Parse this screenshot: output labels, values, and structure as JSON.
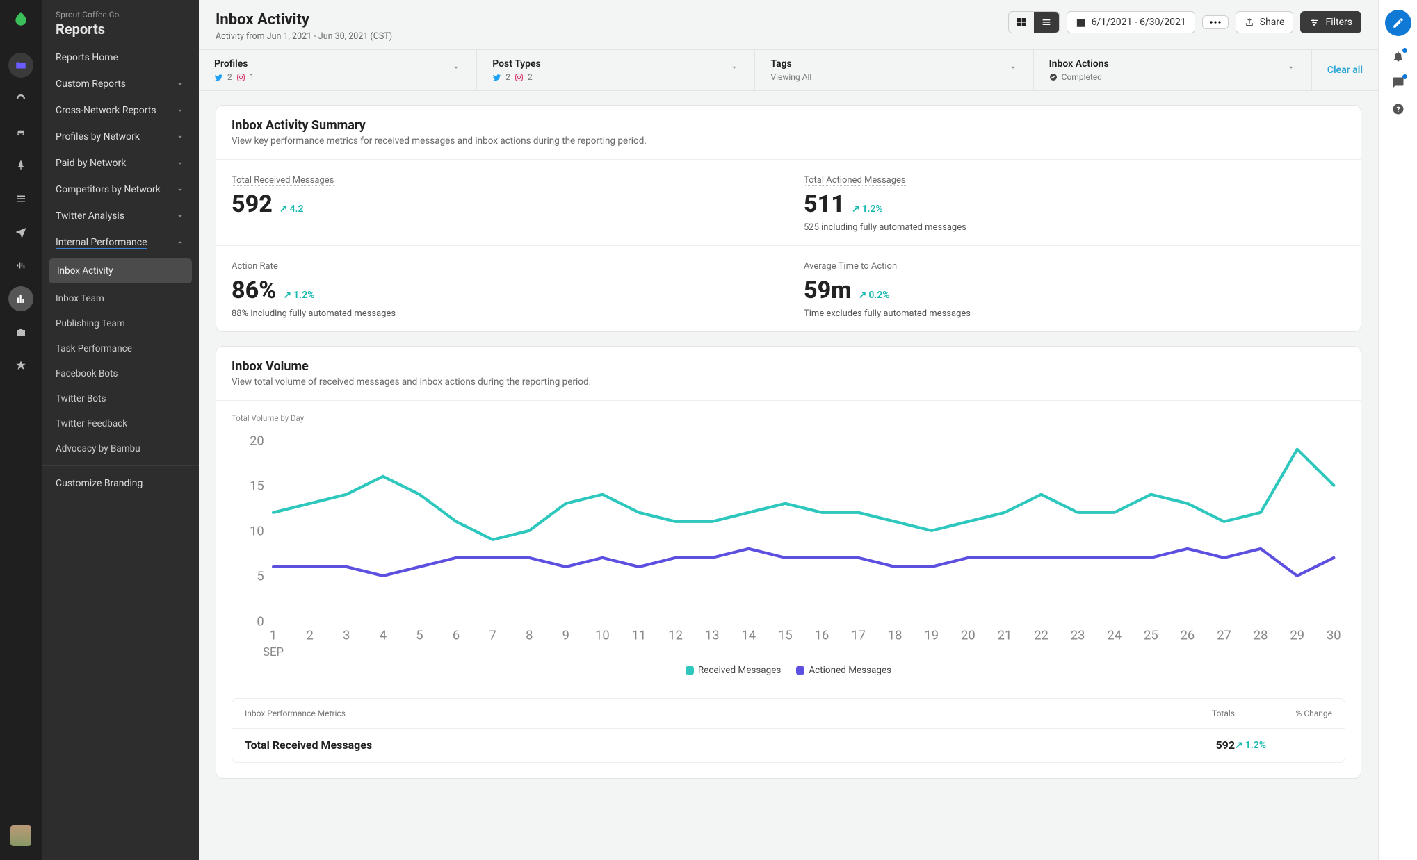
{
  "company": "Sprout Coffee Co.",
  "section": "Reports",
  "page": {
    "title": "Inbox Activity",
    "sub": "Activity from Jun 1, 2021 - Jun 30, 2021 (CST)"
  },
  "toolbar": {
    "date_range": "6/1/2021 - 6/30/2021",
    "share": "Share",
    "filters": "Filters"
  },
  "sidebar": {
    "home": "Reports Home",
    "groups": [
      {
        "label": "Custom Reports"
      },
      {
        "label": "Cross-Network Reports"
      },
      {
        "label": "Profiles by Network"
      },
      {
        "label": "Paid by Network"
      },
      {
        "label": "Competitors by Network"
      },
      {
        "label": "Twitter Analysis"
      },
      {
        "label": "Internal Performance"
      }
    ],
    "subs": [
      "Inbox Activity",
      "Inbox Team",
      "Publishing Team",
      "Task Performance",
      "Facebook Bots",
      "Twitter Bots",
      "Twitter Feedback",
      "Advocacy by Bambu"
    ],
    "customize": "Customize Branding"
  },
  "filters": {
    "profiles": {
      "label": "Profiles",
      "tw": "2",
      "ig": "1"
    },
    "post_types": {
      "label": "Post Types",
      "tw": "2",
      "ig": "2"
    },
    "tags": {
      "label": "Tags",
      "meta": "Viewing All"
    },
    "actions": {
      "label": "Inbox Actions",
      "meta": "Completed"
    },
    "clear": "Clear all"
  },
  "summary": {
    "title": "Inbox Activity Summary",
    "desc": "View key performance metrics for received messages and inbox actions during the reporting period.",
    "m": [
      {
        "label": "Total Received Messages",
        "value": "592",
        "delta": "4.2",
        "note": ""
      },
      {
        "label": "Total Actioned Messages",
        "value": "511",
        "delta": "1.2%",
        "note": "525 including fully automated messages"
      },
      {
        "label": "Action Rate",
        "value": "86%",
        "delta": "1.2%",
        "note": "88% including fully automated messages"
      },
      {
        "label": "Average Time to Action",
        "value": "59m",
        "delta": "0.2%",
        "note": "Time excludes fully automated messages"
      }
    ]
  },
  "volume": {
    "title": "Inbox Volume",
    "desc": "View total volume of received messages and inbox actions during the reporting period.",
    "caption": "Total Volume by Day",
    "legend": {
      "rx": "Received Messages",
      "ax": "Actioned Messages"
    }
  },
  "table": {
    "title": "Inbox Performance Metrics",
    "cols": {
      "totals": "Totals",
      "change": "% Change"
    },
    "rows": [
      {
        "label": "Total Received Messages",
        "total": "592",
        "change": "1.2%"
      }
    ]
  },
  "colors": {
    "teal": "#2dc7bd",
    "purple": "#5d4fe0"
  },
  "chart_data": {
    "type": "line",
    "x": [
      1,
      2,
      3,
      4,
      5,
      6,
      7,
      8,
      9,
      10,
      11,
      12,
      13,
      14,
      15,
      16,
      17,
      18,
      19,
      20,
      21,
      22,
      23,
      24,
      25,
      26,
      27,
      28,
      29,
      30
    ],
    "series": [
      {
        "name": "Received Messages",
        "values": [
          12,
          13,
          14,
          16,
          14,
          11,
          9,
          10,
          13,
          14,
          12,
          11,
          11,
          12,
          13,
          12,
          12,
          11,
          10,
          11,
          12,
          14,
          12,
          12,
          14,
          13,
          11,
          12,
          19,
          15
        ]
      },
      {
        "name": "Actioned Messages",
        "values": [
          6,
          6,
          6,
          5,
          6,
          7,
          7,
          7,
          6,
          7,
          6,
          7,
          7,
          8,
          7,
          7,
          7,
          6,
          6,
          7,
          7,
          7,
          7,
          7,
          7,
          8,
          7,
          8,
          5,
          7
        ]
      }
    ],
    "xlabel": "SEP",
    "ylabel": "",
    "ylim": [
      0,
      20
    ],
    "yticks": [
      0,
      5,
      10,
      15,
      20
    ]
  }
}
